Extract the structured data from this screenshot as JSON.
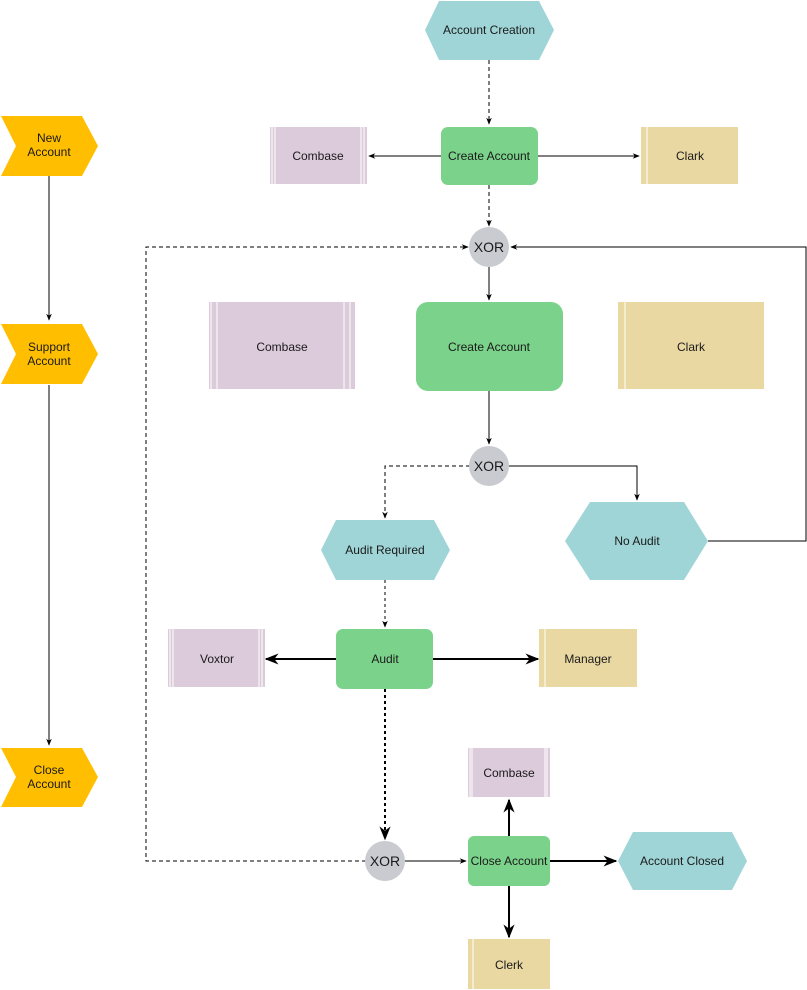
{
  "colors": {
    "event": "#a0d5d8",
    "function": "#7bd38b",
    "system": "#dccbdb",
    "role": "#ead8a2",
    "process_path": "#ffbf00",
    "xor": "#c9cbd0",
    "line": "#000000"
  },
  "process_paths": [
    {
      "id": "pp-new",
      "lines": [
        "New",
        "Account"
      ]
    },
    {
      "id": "pp-support",
      "lines": [
        "Support",
        "Account"
      ]
    },
    {
      "id": "pp-close",
      "lines": [
        "Close",
        "Account"
      ]
    }
  ],
  "events": [
    {
      "id": "ev-creation",
      "label": "Account Creation"
    },
    {
      "id": "ev-audit-required",
      "label": "Audit Required"
    },
    {
      "id": "ev-no-audit",
      "label": "No Audit"
    },
    {
      "id": "ev-closed",
      "label": "Account Closed"
    }
  ],
  "functions": [
    {
      "id": "fn-create-1",
      "label": "Create Account"
    },
    {
      "id": "fn-create-2",
      "label": "Create Account"
    },
    {
      "id": "fn-audit",
      "label": "Audit"
    },
    {
      "id": "fn-close",
      "label": "Close Account"
    }
  ],
  "systems": [
    {
      "id": "sys-combase-1",
      "label": "Combase"
    },
    {
      "id": "sys-combase-2",
      "label": "Combase"
    },
    {
      "id": "sys-voxtor",
      "label": "Voxtor"
    },
    {
      "id": "sys-combase-3",
      "label": "Combase"
    }
  ],
  "roles": [
    {
      "id": "role-clark-1",
      "label": "Clark"
    },
    {
      "id": "role-clark-2",
      "label": "Clark"
    },
    {
      "id": "role-manager",
      "label": "Manager"
    },
    {
      "id": "role-clerk",
      "label": "Clerk"
    }
  ],
  "gateways": [
    {
      "id": "xor-1",
      "label": "XOR"
    },
    {
      "id": "xor-2",
      "label": "XOR"
    },
    {
      "id": "xor-3",
      "label": "XOR"
    }
  ]
}
